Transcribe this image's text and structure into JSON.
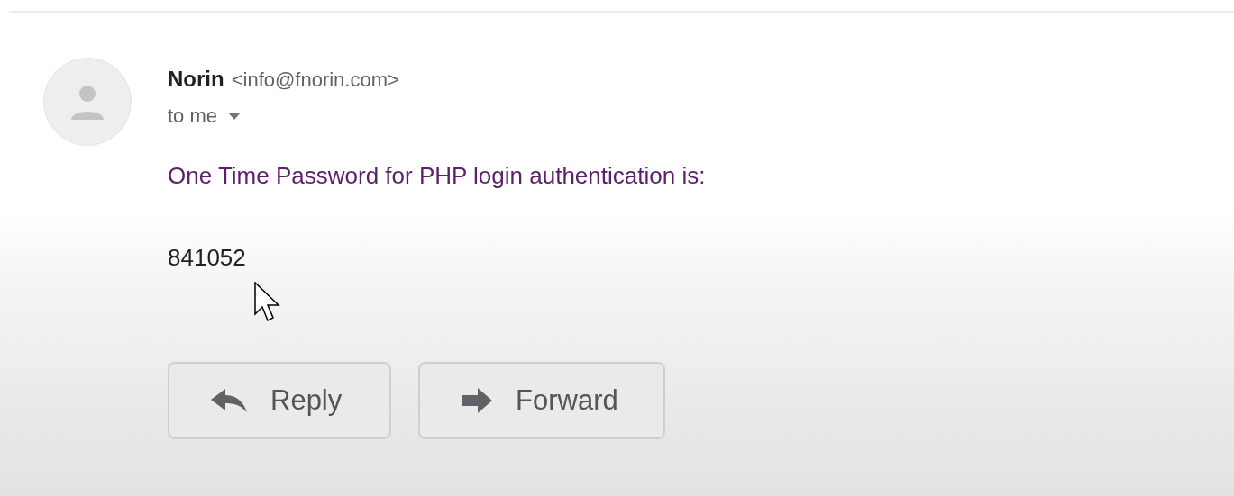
{
  "sender": {
    "name": "Norin",
    "email": "<info@fnorin.com>"
  },
  "recipient": {
    "label": "to me"
  },
  "body": {
    "message": "One Time Password for PHP login authentication is:",
    "code": "841052"
  },
  "actions": [
    {
      "kind": "reply",
      "label": "Reply"
    },
    {
      "kind": "forward",
      "label": "Forward"
    }
  ]
}
